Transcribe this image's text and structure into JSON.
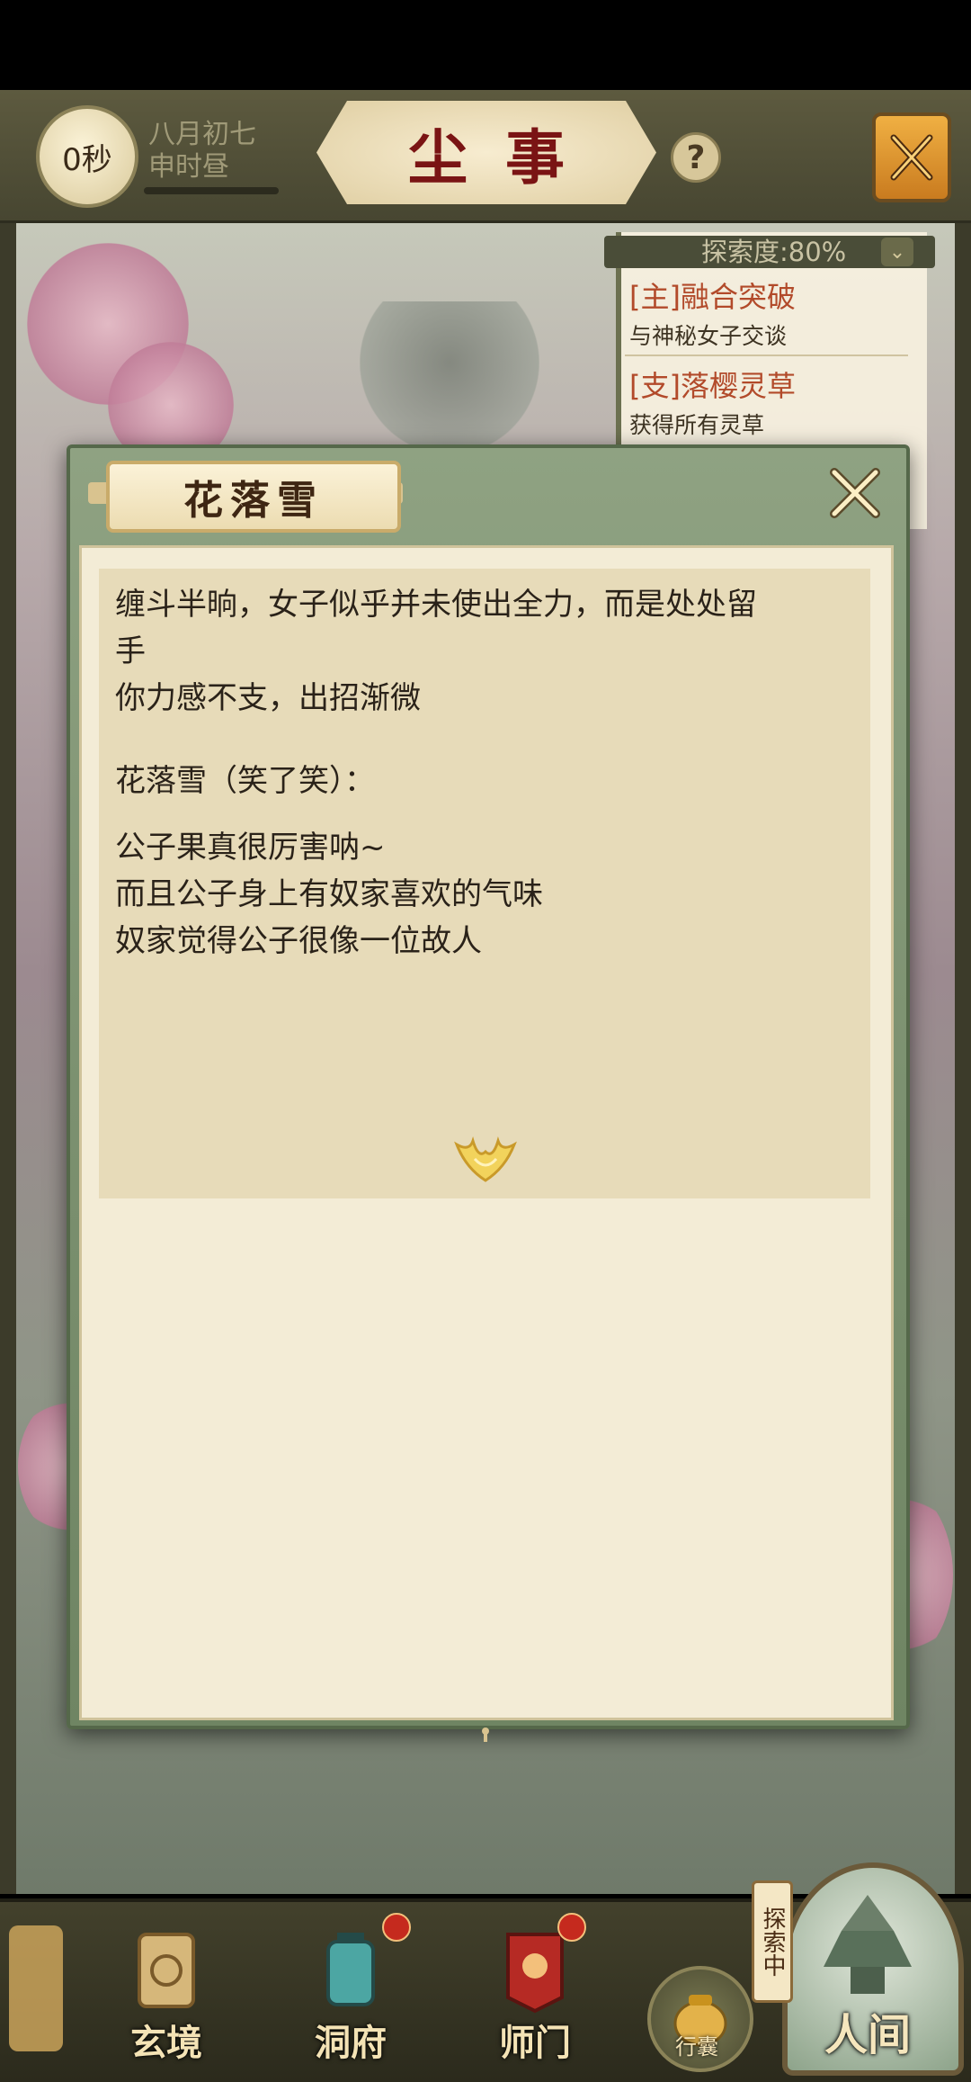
{
  "hud": {
    "timer": "0秒",
    "date_line1": "八月初七",
    "date_line2": "申时昼",
    "title": "尘事",
    "help": "?"
  },
  "quest": {
    "explore_label": "探索度:80%",
    "main_title": "[主]融合突破",
    "main_desc": "与神秘女子交谈",
    "side_title": "[支]落樱灵草",
    "side_desc": "获得所有灵草"
  },
  "dialog": {
    "speaker": "花落雪",
    "lines": [
      "缠斗半晌，女子似乎并未使出全力，而是处处留",
      "手",
      "你力感不支，出招渐微",
      "花落雪（笑了笑）：",
      "公子果真很厉害呐~",
      "而且公子身上有奴家喜欢的气味",
      "奴家觉得公子很像一位故人"
    ]
  },
  "nav": {
    "xuanjing": "玄境",
    "dongfu": "洞府",
    "shimen": "师门",
    "xingnang": "行囊",
    "renjian": "人间",
    "tansuo": "探索中"
  },
  "colors": {
    "title_red": "#7a1414",
    "quest_main": "#b24a2a",
    "dialog_frame": "#7c9170",
    "parchment": "#f3ecd6"
  }
}
